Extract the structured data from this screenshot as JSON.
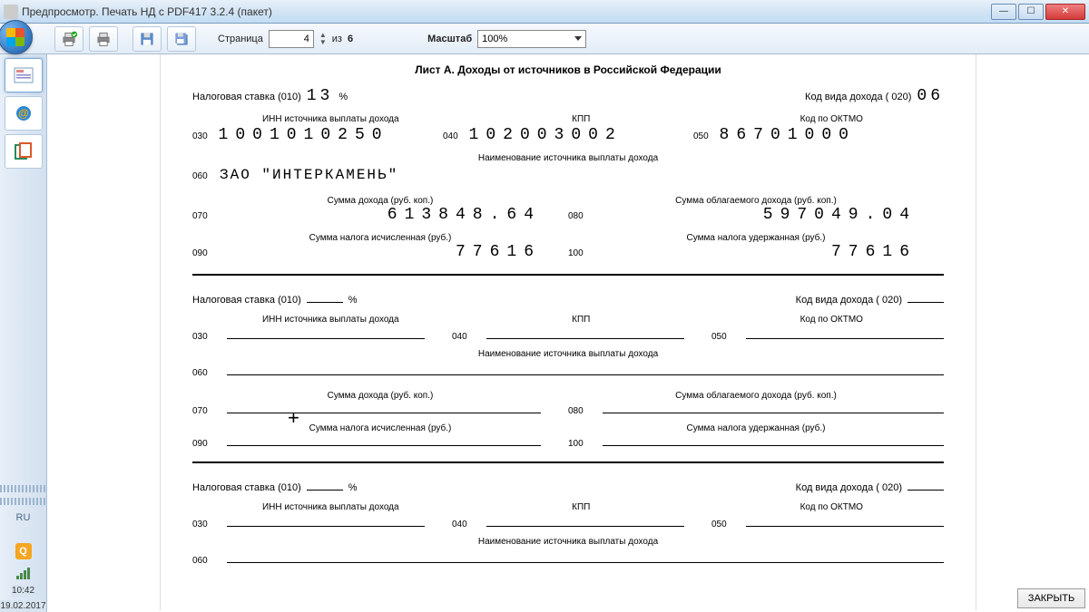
{
  "window": {
    "title": "Предпросмотр. Печать НД с PDF417 3.2.4 (пакет)"
  },
  "toolbar": {
    "page_label": "Страница",
    "page_value": "4",
    "page_of": "из",
    "page_total": "6",
    "zoom_label": "Масштаб",
    "zoom_value": "100%"
  },
  "tray": {
    "lang": "RU",
    "time": "10:42",
    "date": "19.02.2017"
  },
  "close_button": "ЗАКРЫТЬ",
  "doc": {
    "title": "Лист А. Доходы от источников в Российской Федерации",
    "labels": {
      "tax_rate": "Налоговая ставка (010)",
      "percent": "%",
      "income_code": "Код вида дохода ( 020)",
      "inn_source": "ИНН источника выплаты дохода",
      "kpp": "КПП",
      "oktmo": "Код по ОКТМО",
      "source_name": "Наименование источника выплаты дохода",
      "income_sum": "Сумма дохода (руб. коп.)",
      "taxable_sum": "Сумма облагаемого дохода (руб. коп.)",
      "tax_calc": "Сумма налога исчисленная (руб.)",
      "tax_withheld": "Сумма налога удержанная (руб.)"
    },
    "codes": {
      "c030": "030",
      "c040": "040",
      "c050": "050",
      "c060": "060",
      "c070": "070",
      "c080": "080",
      "c090": "090",
      "c100": "100"
    },
    "block1": {
      "rate": "13",
      "income_type": "06",
      "inn": "1001010250",
      "kpp": "102003002",
      "oktmo": "86701000",
      "name": "ЗАО \"ИНТЕРКАМЕНЬ\"",
      "income": "613848.64",
      "taxable": "597049.04",
      "tax_calc": "77616",
      "tax_withheld": "77616"
    }
  }
}
